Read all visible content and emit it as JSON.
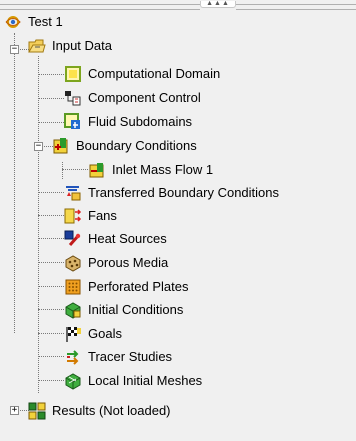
{
  "tree": {
    "root": {
      "label": "Test 1",
      "icon": "project-eye-icon"
    },
    "input_data": {
      "label": "Input Data",
      "icon": "folder-input-icon",
      "expander": "−"
    },
    "items": [
      {
        "label": "Computational Domain",
        "icon": "domain-box-icon"
      },
      {
        "label": "Component Control",
        "icon": "component-control-icon"
      },
      {
        "label": "Fluid Subdomains",
        "icon": "fluid-subdomain-icon"
      },
      {
        "label": "Boundary Conditions",
        "icon": "boundary-conditions-icon",
        "expander": "−"
      },
      {
        "label": "Inlet Mass Flow 1",
        "icon": "inlet-mass-flow-icon"
      },
      {
        "label": "Transferred Boundary Conditions",
        "icon": "transferred-bc-icon"
      },
      {
        "label": "Fans",
        "icon": "fan-icon"
      },
      {
        "label": "Heat Sources",
        "icon": "heat-source-icon"
      },
      {
        "label": "Porous Media",
        "icon": "porous-media-icon"
      },
      {
        "label": "Perforated Plates",
        "icon": "perforated-plate-icon"
      },
      {
        "label": "Initial Conditions",
        "icon": "initial-conditions-icon"
      },
      {
        "label": "Goals",
        "icon": "goals-flag-icon"
      },
      {
        "label": "Tracer Studies",
        "icon": "tracer-study-icon"
      },
      {
        "label": "Local Initial Meshes",
        "icon": "local-mesh-icon"
      }
    ],
    "results": {
      "label": "Results (Not loaded)",
      "icon": "results-icon",
      "expander": "+"
    }
  },
  "splitter_grip": "▲▲▲"
}
